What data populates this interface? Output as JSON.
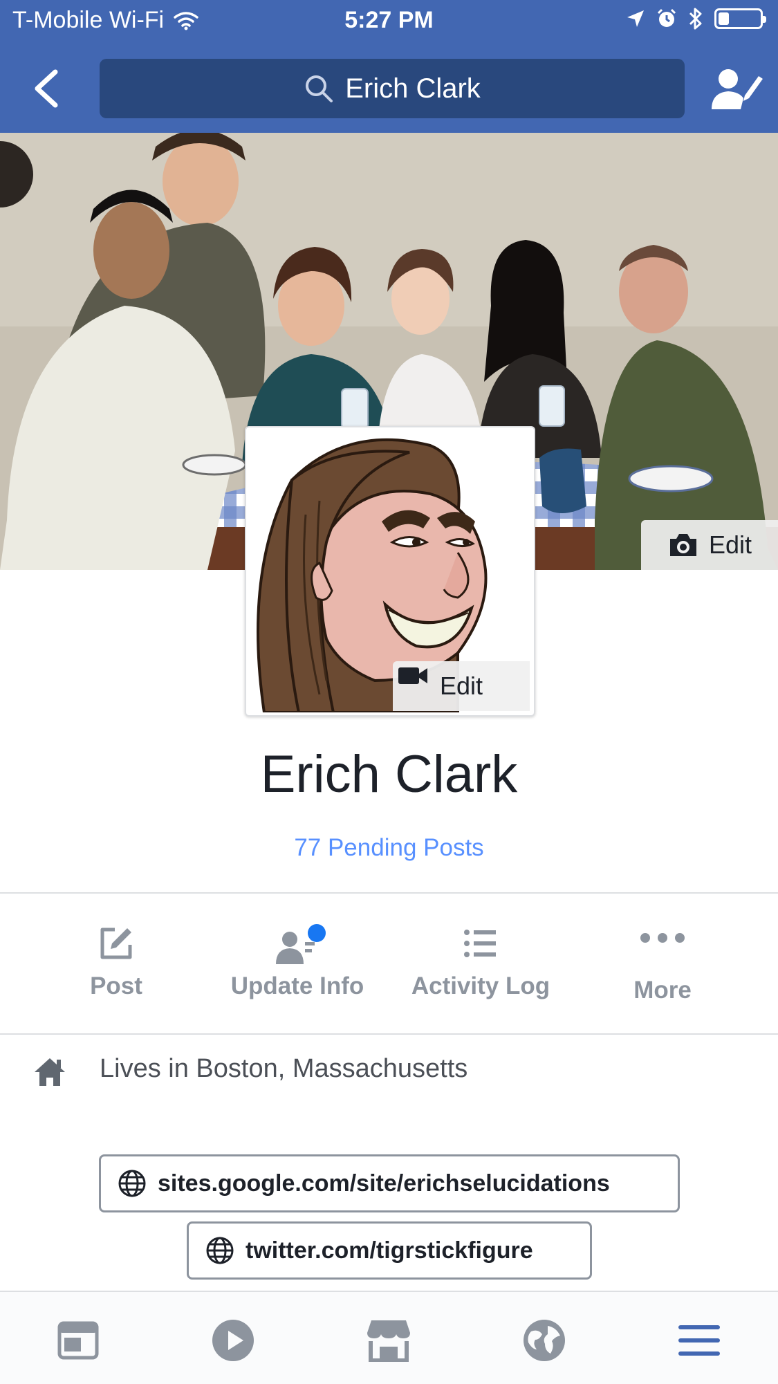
{
  "status_bar": {
    "carrier": "T-Mobile Wi-Fi",
    "time": "5:27 PM",
    "battery_level": 0.25
  },
  "nav": {
    "search_text": "Erich Clark"
  },
  "cover": {
    "edit_label": "Edit"
  },
  "profile_picture": {
    "edit_label": "Edit"
  },
  "profile": {
    "name": "Erich Clark",
    "pending_posts": "77 Pending Posts"
  },
  "actions": [
    {
      "label": "Post",
      "icon": "compose-icon"
    },
    {
      "label": "Update Info",
      "icon": "update-info-icon",
      "badge": true
    },
    {
      "label": "Activity Log",
      "icon": "list-icon"
    },
    {
      "label": "More",
      "icon": "more-dots-icon"
    }
  ],
  "info": {
    "lives_in": "Lives in Boston, Massachusetts"
  },
  "links": [
    {
      "url": "sites.google.com/site/erichselucidations"
    },
    {
      "url": "twitter.com/tigrstickfigure"
    }
  ],
  "tab_bar": {
    "items": [
      "news-feed-icon",
      "video-icon",
      "marketplace-icon",
      "globe-icon",
      "menu-icon"
    ],
    "active": "menu-icon"
  },
  "colors": {
    "brand": "#4267b2",
    "search_bg": "#29487d",
    "link": "#5890ff",
    "muted": "#8d949e",
    "badge": "#1877f2"
  }
}
